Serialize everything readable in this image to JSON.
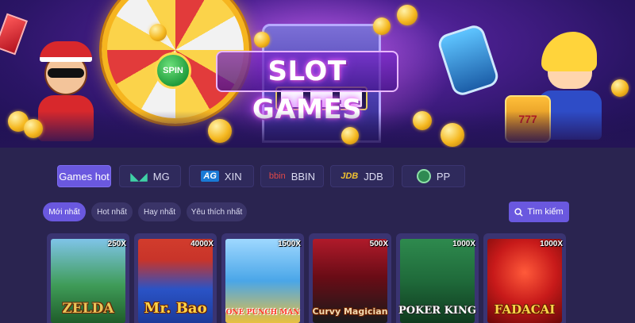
{
  "banner": {
    "title": "SLOT GAMES",
    "spin_label": "SPIN",
    "slot_right_label": "777"
  },
  "providers": [
    {
      "label": "Games hot",
      "logo": "",
      "active": true
    },
    {
      "label": "MG",
      "logo": "mg-logo-icon",
      "active": false
    },
    {
      "label": "XIN",
      "logo": "AG",
      "active": false
    },
    {
      "label": "BBIN",
      "logo": "bbin",
      "active": false
    },
    {
      "label": "JDB",
      "logo": "JDB",
      "active": false
    },
    {
      "label": "PP",
      "logo": "pp-logo-icon",
      "active": false
    }
  ],
  "filters": [
    {
      "label": "Mới nhất",
      "active": true
    },
    {
      "label": "Hot nhất",
      "active": false
    },
    {
      "label": "Hay nhất",
      "active": false
    },
    {
      "label": "Yêu thích nhất",
      "active": false
    }
  ],
  "search": {
    "label": "Tìm kiếm",
    "icon": "search-icon"
  },
  "games": [
    {
      "name": "ZELDA",
      "multiplier": "250X",
      "color": "#2f8f3a"
    },
    {
      "name": "Mr. Bao",
      "multiplier": "4000X",
      "color": "#2a53c6"
    },
    {
      "name": "ONE PUNCH MAN",
      "multiplier": "1500X",
      "color": "#4aa6e8"
    },
    {
      "name": "Curvy Magician",
      "multiplier": "500X",
      "color": "#7a1020"
    },
    {
      "name": "POKER KING",
      "multiplier": "1000X",
      "color": "#1f6a3a"
    },
    {
      "name": "FADACAI",
      "multiplier": "1000X",
      "color": "#b0161a"
    }
  ],
  "colors": {
    "background": "#2a2450",
    "accent": "#6a58df",
    "tab_bg": "#2f2a5c",
    "chip_bg": "#3a3468"
  }
}
